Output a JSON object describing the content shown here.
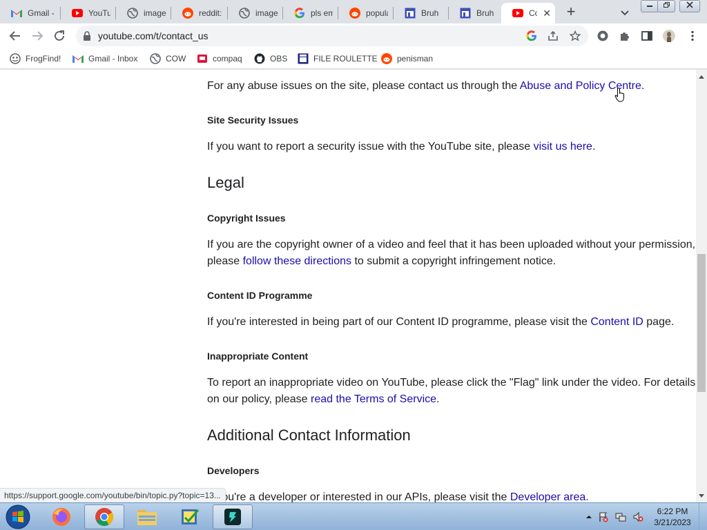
{
  "tabs": [
    {
      "label": "Gmail -",
      "icon": "gmail-icon"
    },
    {
      "label": "YouTub",
      "icon": "youtube-icon"
    },
    {
      "label": "images",
      "icon": "globe-icon"
    },
    {
      "label": "reddit:",
      "icon": "reddit-icon"
    },
    {
      "label": "images",
      "icon": "globe-icon"
    },
    {
      "label": "pls emc",
      "icon": "google-icon"
    },
    {
      "label": "popula",
      "icon": "reddit-icon"
    },
    {
      "label": "Bruh",
      "icon": "window-icon"
    },
    {
      "label": "Bruh",
      "icon": "window-icon"
    },
    {
      "label": "Cor",
      "icon": "youtube-icon",
      "active": true
    }
  ],
  "omnibox": {
    "url": "youtube.com/t/contact_us"
  },
  "bookmarks": [
    {
      "label": "FrogFind!",
      "icon": "frog-icon"
    },
    {
      "label": "Gmail - Inbox",
      "icon": "gmail-icon"
    },
    {
      "label": "COW",
      "icon": "globe-icon"
    },
    {
      "label": "compaq",
      "icon": "compaq-icon"
    },
    {
      "label": "OBS",
      "icon": "github-icon"
    },
    {
      "label": "FILE ROULETTE",
      "icon": "file-roulette-icon"
    },
    {
      "label": "penisman",
      "icon": "reddit-icon"
    }
  ],
  "content": {
    "abuse_pre": "For any abuse issues on the site, please contact us through the ",
    "abuse_link": "Abuse and Policy Centre",
    "abuse_post": ".",
    "security_heading": "Site Security Issues",
    "security_pre": "If you want to report a security issue with the YouTube site, please ",
    "security_link": "visit us here",
    "security_post": ".",
    "legal_heading": "Legal",
    "copyright_heading": "Copyright Issues",
    "copyright_line1": "If you are the copyright owner of a video and feel that it has been uploaded without your permission,",
    "copyright_pre2": "please ",
    "copyright_link": "follow these directions",
    "copyright_post2": " to submit a copyright infringement notice.",
    "contentid_heading": "Content ID Programme",
    "contentid_pre": "If you're interested in being part of our Content ID programme, please visit the ",
    "contentid_link": "Content ID",
    "contentid_post": " page.",
    "inappropriate_heading": "Inappropriate Content",
    "inappropriate_line1": "To report an inappropriate video on YouTube, please click the \"Flag\" link under the video. For details",
    "inappropriate_pre2": "on our policy, please ",
    "inappropriate_link": "read the Terms of Service",
    "inappropriate_post2": ".",
    "additional_heading": "Additional Contact Information",
    "developers_heading": "Developers",
    "developers_pre": "If you're a developer or interested in our APIs, please visit the ",
    "developers_link": "Developer area",
    "developers_post": "."
  },
  "status_url": "https://support.google.com/youtube/bin/topic.py?topic=13...",
  "clock": {
    "time": "6:22 PM",
    "date": "3/21/2023"
  }
}
